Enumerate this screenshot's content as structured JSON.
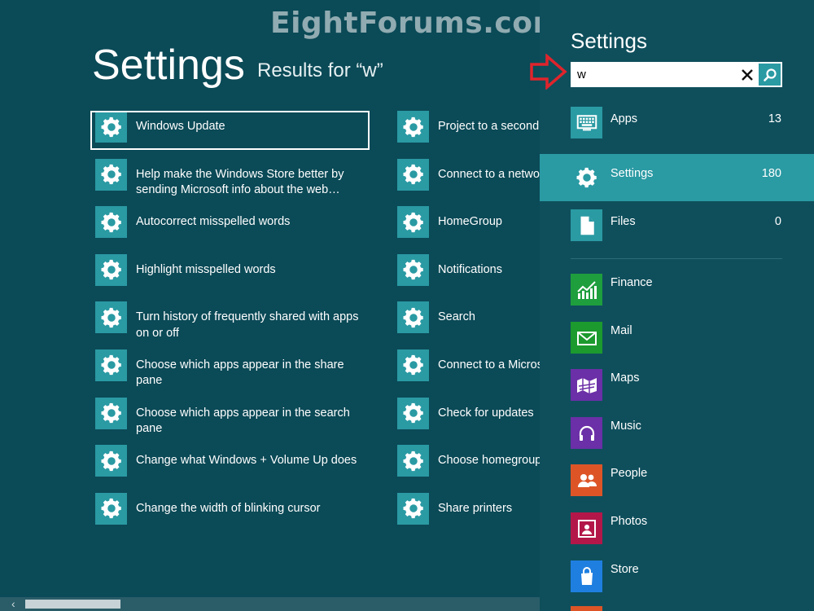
{
  "watermark": "EightForums.com",
  "main": {
    "title": "Settings",
    "results_label": "Results for “w”",
    "column1": [
      {
        "label": "Windows Update"
      },
      {
        "label": "Help make the Windows Store better by sending Microsoft info about the web…"
      },
      {
        "label": "Autocorrect misspelled words"
      },
      {
        "label": "Highlight misspelled words"
      },
      {
        "label": "Turn history of frequently shared with apps on or off"
      },
      {
        "label": "Choose which apps appear in the share pane"
      },
      {
        "label": "Choose which apps appear in the search pane"
      },
      {
        "label": "Change what Windows + Volume Up does"
      },
      {
        "label": "Change the width of blinking cursor"
      }
    ],
    "column2": [
      {
        "label": "Project to a second"
      },
      {
        "label": "Connect to a netwo"
      },
      {
        "label": "HomeGroup"
      },
      {
        "label": "Notifications"
      },
      {
        "label": "Search"
      },
      {
        "label": "Connect to a Micros"
      },
      {
        "label": "Check for updates"
      },
      {
        "label": "Choose homegroup"
      },
      {
        "label": "Share printers"
      }
    ],
    "item_icon": "gear-icon"
  },
  "pane": {
    "title": "Settings",
    "search": {
      "value": "w",
      "placeholder": ""
    },
    "scopes": [
      {
        "name": "Apps",
        "count": "13",
        "icon": "keyboard-icon"
      },
      {
        "name": "Settings",
        "count": "180",
        "icon": "gear-icon"
      },
      {
        "name": "Files",
        "count": "0",
        "icon": "file-icon"
      }
    ],
    "apps": [
      {
        "name": "Finance",
        "color": "#1e9e3d",
        "icon": "finance-chart-icon"
      },
      {
        "name": "Mail",
        "color": "#1c9a2e",
        "icon": "mail-envelope-icon"
      },
      {
        "name": "Maps",
        "color": "#6b2fa7",
        "icon": "map-icon"
      },
      {
        "name": "Music",
        "color": "#6b2fa7",
        "icon": "headphones-icon"
      },
      {
        "name": "People",
        "color": "#dd5527",
        "icon": "people-icon"
      },
      {
        "name": "Photos",
        "color": "#b3174a",
        "icon": "photo-frame-icon"
      },
      {
        "name": "Store",
        "color": "#1f7fe0",
        "icon": "shopping-bag-icon"
      }
    ]
  },
  "colors": {
    "accent": "#2a9aa3",
    "background": "#0b4a57",
    "pane": "#0f4f5c"
  }
}
